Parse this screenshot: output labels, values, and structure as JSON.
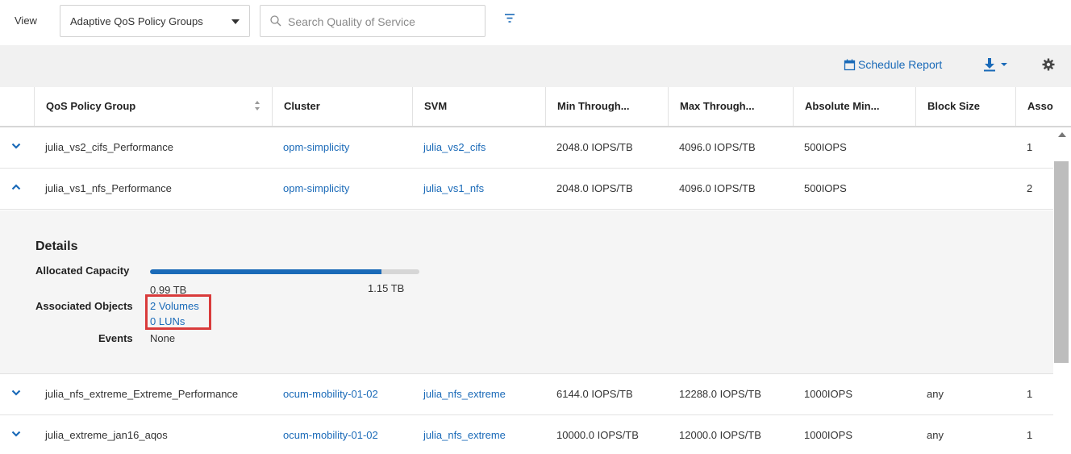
{
  "toolbar": {
    "view_label": "View",
    "view_selected": "Adaptive QoS Policy Groups",
    "search_placeholder": "Search Quality of Service"
  },
  "actions": {
    "schedule_report": "Schedule Report"
  },
  "columns": [
    "QoS Policy Group",
    "Cluster",
    "SVM",
    "Min Through...",
    "Max Through...",
    "Absolute Min...",
    "Block Size",
    "Asso"
  ],
  "rows": [
    {
      "name": "julia_vs2_cifs_Performance",
      "cluster": "opm-simplicity",
      "svm": "julia_vs2_cifs",
      "min": "2048.0 IOPS/TB",
      "max": "4096.0 IOPS/TB",
      "abs_min": "500IOPS",
      "block": "",
      "asso": "1",
      "expanded": false
    },
    {
      "name": "julia_vs1_nfs_Performance",
      "cluster": "opm-simplicity",
      "svm": "julia_vs1_nfs",
      "min": "2048.0 IOPS/TB",
      "max": "4096.0 IOPS/TB",
      "abs_min": "500IOPS",
      "block": "",
      "asso": "2",
      "expanded": true
    },
    {
      "name": "julia_nfs_extreme_Extreme_Performance",
      "cluster": "ocum-mobility-01-02",
      "svm": "julia_nfs_extreme",
      "min": "6144.0 IOPS/TB",
      "max": "12288.0 IOPS/TB",
      "abs_min": "1000IOPS",
      "block": "any",
      "asso": "1",
      "expanded": false
    },
    {
      "name": "julia_extreme_jan16_aqos",
      "cluster": "ocum-mobility-01-02",
      "svm": "julia_nfs_extreme",
      "min": "10000.0 IOPS/TB",
      "max": "12000.0 IOPS/TB",
      "abs_min": "1000IOPS",
      "block": "any",
      "asso": "1",
      "expanded": false
    }
  ],
  "details": {
    "title": "Details",
    "allocated_capacity_label": "Allocated Capacity",
    "capacity_used": "0.99 TB",
    "capacity_total": "1.15 TB",
    "capacity_fraction": 0.86,
    "associated_objects_label": "Associated Objects",
    "volumes_link": "2 Volumes",
    "luns_link": "0 LUNs",
    "events_label": "Events",
    "events_value": "None"
  },
  "colors": {
    "link": "#1a6ab8",
    "highlight_box": "#d93b3b",
    "capacity_fill": "#1a6ab8"
  },
  "icons": {
    "search": "search-icon",
    "filter": "filter-icon",
    "calendar": "calendar-icon",
    "download": "download-icon",
    "settings": "gear-icon",
    "expand": "chevron-down-icon",
    "collapse": "chevron-up-icon",
    "sort": "sort-icon"
  }
}
